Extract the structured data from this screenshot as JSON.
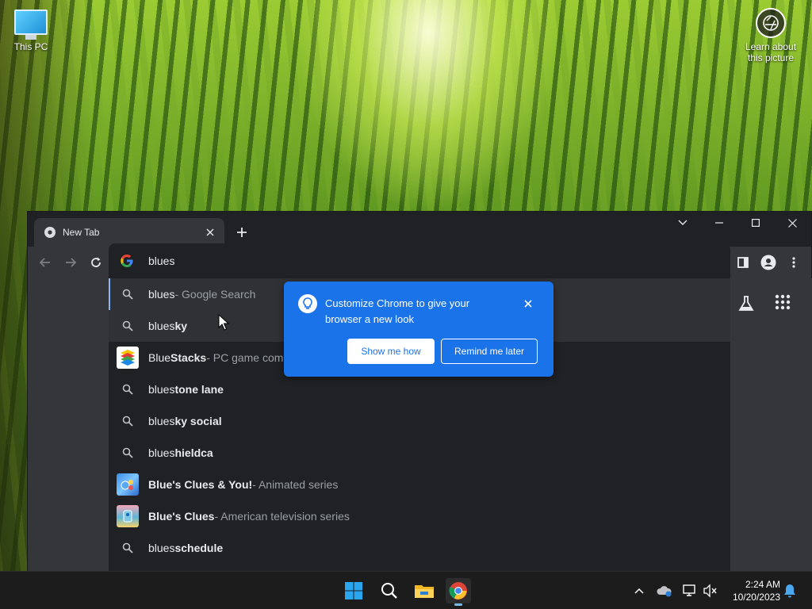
{
  "desktop": {
    "icons": [
      {
        "label": "This PC",
        "icon": "monitor-icon"
      },
      {
        "label": "Learn about\nthis picture",
        "line1": "Learn about",
        "line2": "this picture",
        "icon": "camera-icon"
      }
    ]
  },
  "browser": {
    "tab": {
      "title": "New Tab",
      "favicon": "chrome-icon"
    },
    "omnibox": {
      "value": "blues",
      "icon": "google-g-icon"
    },
    "suggestions": [
      {
        "typed": "blues",
        "bold": "",
        "desc": " - Google Search",
        "icon": "search-icon"
      },
      {
        "typed": "blues",
        "bold": "ky",
        "desc": "",
        "icon": "search-icon"
      },
      {
        "typed": "Blue",
        "bold": "Stacks",
        "desc": " - PC game comp",
        "icon": "bluestacks-icon"
      },
      {
        "typed": "blues",
        "bold": "tone lane",
        "desc": "",
        "icon": "search-icon"
      },
      {
        "typed": "blues",
        "bold": "ky social",
        "desc": "",
        "icon": "search-icon"
      },
      {
        "typed": "blues",
        "bold": "hieldca",
        "desc": "",
        "icon": "search-icon"
      },
      {
        "typed": "",
        "bold": "Blue's Clues & You!",
        "desc": " - Animated series",
        "icon": "blues-clues-you-thumb"
      },
      {
        "typed": "",
        "bold": "Blue's Clues",
        "desc": " - American television series",
        "icon": "blues-clues-thumb"
      },
      {
        "typed": "blues",
        "bold": " schedule",
        "desc": "",
        "icon": "search-icon"
      }
    ],
    "bubble": {
      "message": "Customize Chrome to give your browser a new look",
      "primary_label": "Show me how",
      "secondary_label": "Remind me later"
    }
  },
  "taskbar": {
    "apps": [
      "windows-start-icon",
      "search-icon",
      "file-explorer-icon",
      "chrome-icon"
    ],
    "clock": {
      "time": "2:24 AM",
      "date": "10/20/2023"
    }
  },
  "colors": {
    "accent": "#1a73e8",
    "omnibox_bg": "#202124",
    "toolbar_bg": "#35363a",
    "taskbar_bg": "#1c1c1c"
  }
}
